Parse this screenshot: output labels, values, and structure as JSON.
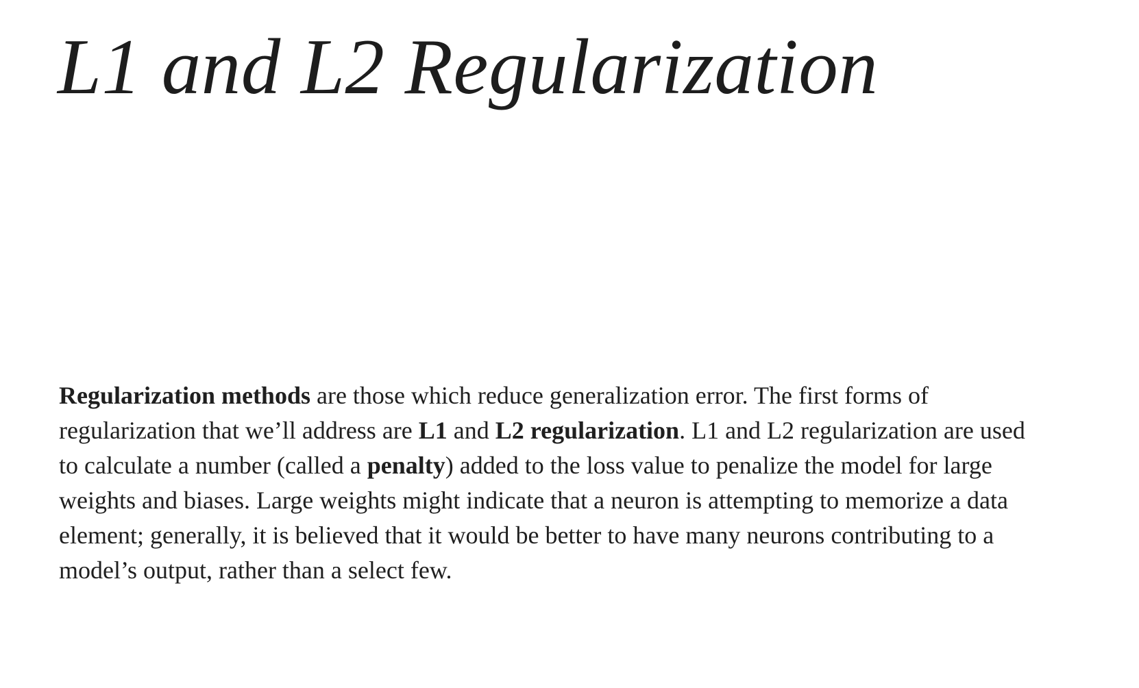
{
  "title": "L1 and L2 Regularization",
  "paragraph": {
    "line1": {
      "b1": "Regularization methods",
      "t1": " are those which reduce generalization error. The first forms of"
    },
    "line2": {
      "t1": "regularization that we’ll address are ",
      "b1": "L1",
      "t2": " and ",
      "b2": "L2 regularization",
      "t3": ". L1 and L2 regularization are used"
    },
    "line3": {
      "t1": "to calculate a number (called a ",
      "b1": "penalty",
      "t2": ") added to the loss value to penalize the model for large"
    },
    "line4": {
      "t1": "weights and biases. Large weights might indicate that a neuron is attempting to memorize a data"
    },
    "line5": {
      "t1": "element; generally, it is believed that it would be better to have many neurons contributing to a"
    },
    "line6": {
      "t1": "model’s output, rather than a select few."
    }
  }
}
